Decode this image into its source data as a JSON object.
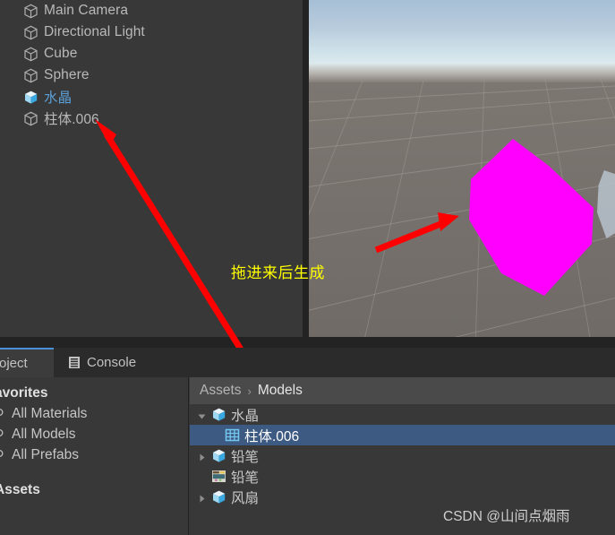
{
  "hierarchy": {
    "items": [
      {
        "label": "Main Camera",
        "icon": "gameobject-cube-icon",
        "kind": "gameobject"
      },
      {
        "label": "Directional Light",
        "icon": "gameobject-cube-icon",
        "kind": "gameobject"
      },
      {
        "label": "Cube",
        "icon": "gameobject-cube-icon",
        "kind": "gameobject"
      },
      {
        "label": "Sphere",
        "icon": "gameobject-cube-icon",
        "kind": "gameobject"
      },
      {
        "label": "水晶",
        "icon": "prefab-box-icon",
        "kind": "prefab"
      },
      {
        "label": "柱体.006",
        "icon": "gameobject-cube-icon",
        "kind": "gameobject"
      }
    ]
  },
  "scene": {
    "annotation_text": "拖进来后生成",
    "annotation_color": "#ffff00",
    "object_color": "#ff00ff",
    "sky_top_color": "#a6bfd6",
    "sky_horizon_color": "#dfecee",
    "ground_color": "#7a7470"
  },
  "tabs": [
    {
      "label": "oject",
      "icon": "project-icon",
      "active": true
    },
    {
      "label": "Console",
      "icon": "console-icon",
      "active": false
    }
  ],
  "project": {
    "breadcrumb": {
      "root": "Assets",
      "separator": "›",
      "current": "Models"
    },
    "favorites": {
      "title": "avorites",
      "items": [
        {
          "label": "All Materials",
          "icon": "search-icon"
        },
        {
          "label": "All Models",
          "icon": "search-icon"
        },
        {
          "label": "All Prefabs",
          "icon": "search-icon"
        }
      ],
      "assets_title": "Assets"
    },
    "assets": [
      {
        "label": "水晶",
        "icon": "prefab-box-icon",
        "arrow": "expanded",
        "indent": 0,
        "selected": false
      },
      {
        "label": "柱体.006",
        "icon": "mesh-grid-icon",
        "arrow": "none",
        "indent": 1,
        "selected": true
      },
      {
        "label": "铅笔",
        "icon": "prefab-box-icon",
        "arrow": "collapsed",
        "indent": 0,
        "selected": false
      },
      {
        "label": "铅笔",
        "icon": "texture-icon",
        "arrow": "none",
        "indent": 0,
        "selected": false
      },
      {
        "label": "风扇",
        "icon": "prefab-box-icon",
        "arrow": "collapsed",
        "indent": 0,
        "selected": false
      }
    ],
    "selection_color": "#3d5a83"
  },
  "watermark": {
    "text": "CSDN @山间点烟雨"
  }
}
